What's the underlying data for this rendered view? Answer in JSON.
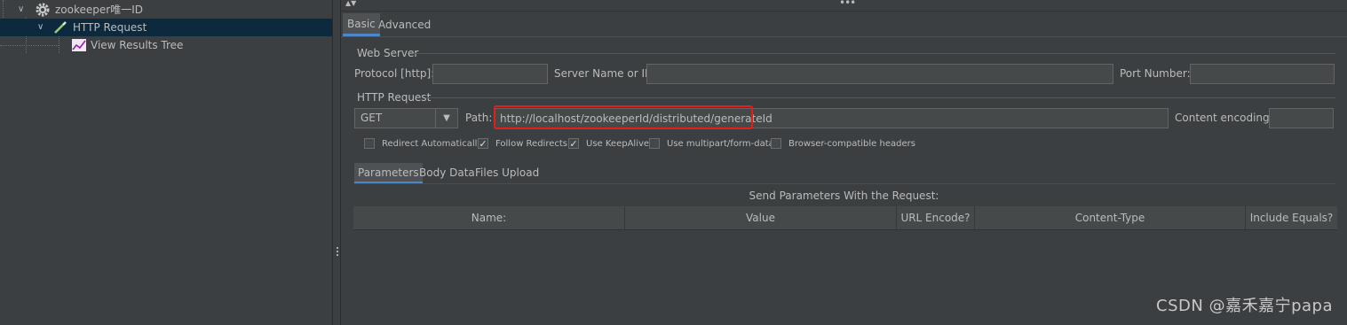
{
  "tree": {
    "items": [
      {
        "label": "zookeeper唯一ID",
        "icon": "gear-icon"
      },
      {
        "label": "HTTP Request",
        "icon": "pipette-icon",
        "selected": true
      },
      {
        "label": "View Results Tree",
        "icon": "chart-icon"
      }
    ]
  },
  "tabs": {
    "basic": "Basic",
    "advanced": "Advanced"
  },
  "web_server": {
    "title": "Web Server",
    "protocol_label": "Protocol [http]:",
    "protocol_value": "",
    "server_label": "Server Name or IP:",
    "server_value": "",
    "port_label": "Port Number:",
    "port_value": ""
  },
  "http_request": {
    "title": "HTTP Request",
    "method": "GET",
    "path_label": "Path:",
    "path_value": "http://localhost/zookeeperId/distributed/generateId",
    "encoding_label": "Content encoding:",
    "encoding_value": ""
  },
  "options": [
    {
      "label": "Redirect Automatically",
      "checked": false
    },
    {
      "label": "Follow Redirects",
      "checked": true
    },
    {
      "label": "Use KeepAlive",
      "checked": true
    },
    {
      "label": "Use multipart/form-data",
      "checked": false
    },
    {
      "label": "Browser-compatible headers",
      "checked": false
    }
  ],
  "subtabs": {
    "parameters": "Parameters",
    "body_data": "Body Data",
    "files_upload": "Files Upload"
  },
  "params_table": {
    "caption": "Send Parameters With the Request:",
    "columns": [
      "Name:",
      "Value",
      "URL Encode?",
      "Content-Type",
      "Include Equals?"
    ]
  },
  "watermark": "CSDN @嘉禾嘉宁papa",
  "colors": {
    "background": "#3c3f41",
    "selection": "#0d293e",
    "accent": "#4a88c7",
    "highlight": "#e0201b"
  }
}
